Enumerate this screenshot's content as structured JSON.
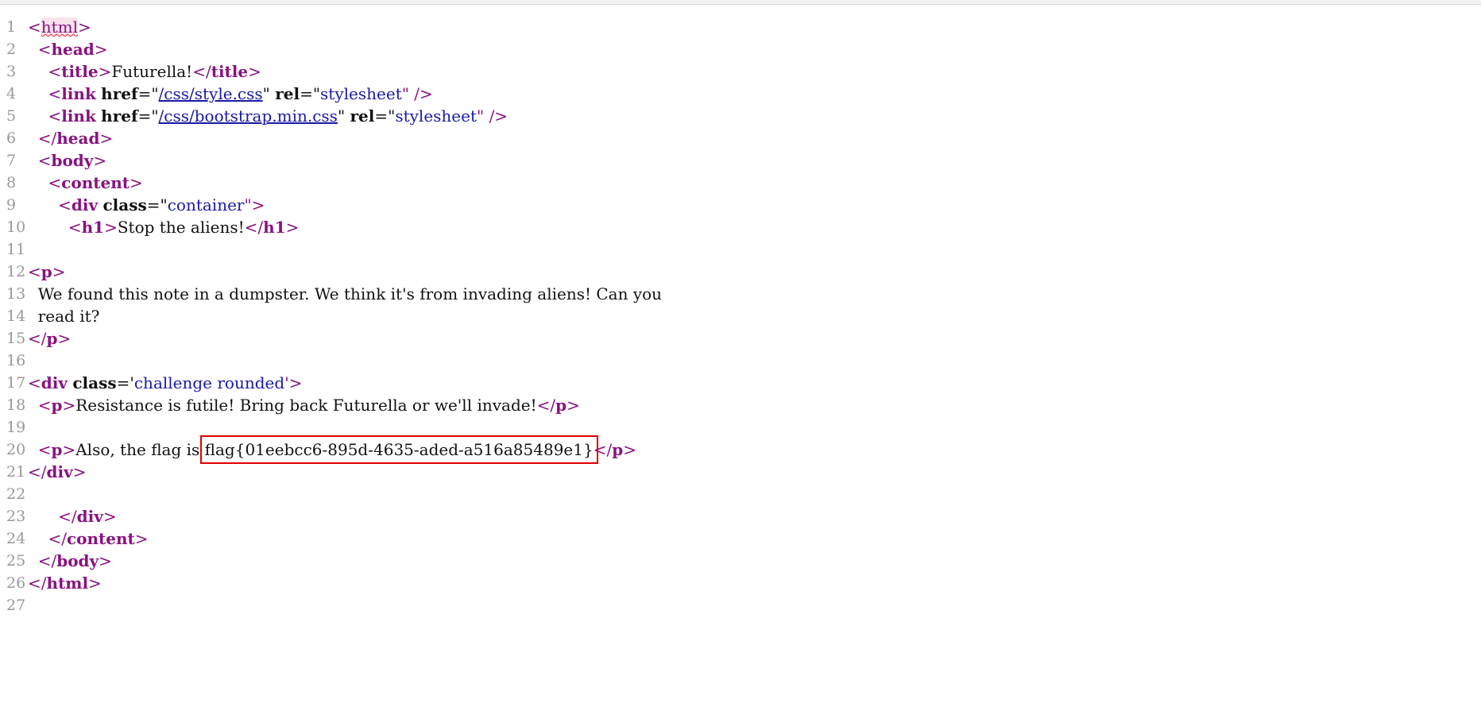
{
  "lines": [
    {
      "n": "1",
      "indent": "",
      "parts": [
        {
          "t": "<",
          "c": "br"
        },
        {
          "t": "html",
          "c": "html-root"
        },
        {
          "t": ">",
          "c": "br"
        }
      ]
    },
    {
      "n": "2",
      "indent": "  ",
      "parts": [
        {
          "t": "<",
          "c": "br"
        },
        {
          "t": "head",
          "c": "tn"
        },
        {
          "t": ">",
          "c": "br"
        }
      ]
    },
    {
      "n": "3",
      "indent": "    ",
      "parts": [
        {
          "t": "<",
          "c": "br"
        },
        {
          "t": "title",
          "c": "tn"
        },
        {
          "t": ">",
          "c": "br"
        },
        {
          "t": "Futurella!",
          "c": "txt"
        },
        {
          "t": "</",
          "c": "br"
        },
        {
          "t": "title",
          "c": "tn"
        },
        {
          "t": ">",
          "c": "br"
        }
      ]
    },
    {
      "n": "4",
      "indent": "    ",
      "parts": [
        {
          "t": "<",
          "c": "br"
        },
        {
          "t": "link",
          "c": "tn"
        },
        {
          "t": " ",
          "c": "txt"
        },
        {
          "t": "href",
          "c": "attr"
        },
        {
          "t": "=\"",
          "c": "txt"
        },
        {
          "t": "/css/style.css",
          "c": "link"
        },
        {
          "t": "\" ",
          "c": "txt"
        },
        {
          "t": "rel",
          "c": "attr"
        },
        {
          "t": "=\"",
          "c": "txt"
        },
        {
          "t": "stylesheet",
          "c": "val"
        },
        {
          "t": "\" />",
          "c": "br"
        }
      ]
    },
    {
      "n": "5",
      "indent": "    ",
      "parts": [
        {
          "t": "<",
          "c": "br"
        },
        {
          "t": "link",
          "c": "tn"
        },
        {
          "t": " ",
          "c": "txt"
        },
        {
          "t": "href",
          "c": "attr"
        },
        {
          "t": "=\"",
          "c": "txt"
        },
        {
          "t": "/css/bootstrap.min.css",
          "c": "link"
        },
        {
          "t": "\" ",
          "c": "txt"
        },
        {
          "t": "rel",
          "c": "attr"
        },
        {
          "t": "=\"",
          "c": "txt"
        },
        {
          "t": "stylesheet",
          "c": "val"
        },
        {
          "t": "\" />",
          "c": "br"
        }
      ]
    },
    {
      "n": "6",
      "indent": "  ",
      "parts": [
        {
          "t": "</",
          "c": "br"
        },
        {
          "t": "head",
          "c": "tn"
        },
        {
          "t": ">",
          "c": "br"
        }
      ]
    },
    {
      "n": "7",
      "indent": "  ",
      "parts": [
        {
          "t": "<",
          "c": "br"
        },
        {
          "t": "body",
          "c": "tn"
        },
        {
          "t": ">",
          "c": "br"
        }
      ]
    },
    {
      "n": "8",
      "indent": "    ",
      "parts": [
        {
          "t": "<",
          "c": "br"
        },
        {
          "t": "content",
          "c": "tn"
        },
        {
          "t": ">",
          "c": "br"
        }
      ]
    },
    {
      "n": "9",
      "indent": "      ",
      "parts": [
        {
          "t": "<",
          "c": "br"
        },
        {
          "t": "div",
          "c": "tn"
        },
        {
          "t": " ",
          "c": "txt"
        },
        {
          "t": "class",
          "c": "attr"
        },
        {
          "t": "=\"",
          "c": "txt"
        },
        {
          "t": "container",
          "c": "val"
        },
        {
          "t": "\">",
          "c": "br"
        }
      ]
    },
    {
      "n": "10",
      "indent": "        ",
      "parts": [
        {
          "t": "<",
          "c": "br"
        },
        {
          "t": "h1",
          "c": "tn"
        },
        {
          "t": ">",
          "c": "br"
        },
        {
          "t": "Stop the aliens!",
          "c": "txt"
        },
        {
          "t": "</",
          "c": "br"
        },
        {
          "t": "h1",
          "c": "tn"
        },
        {
          "t": ">",
          "c": "br"
        }
      ]
    },
    {
      "n": "11",
      "indent": "",
      "parts": []
    },
    {
      "n": "12",
      "indent": "",
      "parts": [
        {
          "t": "<",
          "c": "br"
        },
        {
          "t": "p",
          "c": "tn"
        },
        {
          "t": ">",
          "c": "br"
        }
      ]
    },
    {
      "n": "13",
      "indent": "  ",
      "parts": [
        {
          "t": "We found this note in a dumpster. We think it's from invading aliens! Can you",
          "c": "txt"
        }
      ]
    },
    {
      "n": "14",
      "indent": "  ",
      "parts": [
        {
          "t": "read it?",
          "c": "txt"
        }
      ]
    },
    {
      "n": "15",
      "indent": "",
      "parts": [
        {
          "t": "</",
          "c": "br"
        },
        {
          "t": "p",
          "c": "tn"
        },
        {
          "t": ">",
          "c": "br"
        }
      ]
    },
    {
      "n": "16",
      "indent": "",
      "parts": []
    },
    {
      "n": "17",
      "indent": "",
      "parts": [
        {
          "t": "<",
          "c": "br"
        },
        {
          "t": "div",
          "c": "tn"
        },
        {
          "t": " ",
          "c": "txt"
        },
        {
          "t": "class",
          "c": "attr"
        },
        {
          "t": "='",
          "c": "txt"
        },
        {
          "t": "challenge rounded",
          "c": "val"
        },
        {
          "t": "'>",
          "c": "br"
        }
      ]
    },
    {
      "n": "18",
      "indent": "  ",
      "parts": [
        {
          "t": "<",
          "c": "br"
        },
        {
          "t": "p",
          "c": "tn"
        },
        {
          "t": ">",
          "c": "br"
        },
        {
          "t": "Resistance is futile! Bring back Futurella or we'll invade!",
          "c": "txt"
        },
        {
          "t": "</",
          "c": "br"
        },
        {
          "t": "p",
          "c": "tn"
        },
        {
          "t": ">",
          "c": "br"
        }
      ]
    },
    {
      "n": "19",
      "indent": "",
      "parts": []
    },
    {
      "n": "20",
      "indent": "  ",
      "parts": [
        {
          "t": "<",
          "c": "br"
        },
        {
          "t": "p",
          "c": "tn"
        },
        {
          "t": ">",
          "c": "br"
        },
        {
          "t": "Also, the flag is ",
          "c": "txt"
        },
        {
          "t": "flag{01eebcc6-895d-4635-aded-a516a85489e1}",
          "c": "flag"
        },
        {
          "t": "</",
          "c": "br"
        },
        {
          "t": "p",
          "c": "tn"
        },
        {
          "t": ">",
          "c": "br"
        }
      ]
    },
    {
      "n": "21",
      "indent": "",
      "parts": [
        {
          "t": "</",
          "c": "br"
        },
        {
          "t": "div",
          "c": "tn"
        },
        {
          "t": ">",
          "c": "br"
        }
      ]
    },
    {
      "n": "22",
      "indent": "",
      "parts": []
    },
    {
      "n": "23",
      "indent": "      ",
      "parts": [
        {
          "t": "</",
          "c": "br"
        },
        {
          "t": "div",
          "c": "tn"
        },
        {
          "t": ">",
          "c": "br"
        }
      ]
    },
    {
      "n": "24",
      "indent": "    ",
      "parts": [
        {
          "t": "</",
          "c": "br"
        },
        {
          "t": "content",
          "c": "tn"
        },
        {
          "t": ">",
          "c": "br"
        }
      ]
    },
    {
      "n": "25",
      "indent": "  ",
      "parts": [
        {
          "t": "</",
          "c": "br"
        },
        {
          "t": "body",
          "c": "tn"
        },
        {
          "t": ">",
          "c": "br"
        }
      ]
    },
    {
      "n": "26",
      "indent": "",
      "parts": [
        {
          "t": "</",
          "c": "br"
        },
        {
          "t": "html",
          "c": "tn"
        },
        {
          "t": ">",
          "c": "br"
        }
      ]
    },
    {
      "n": "27",
      "indent": "",
      "parts": []
    }
  ]
}
